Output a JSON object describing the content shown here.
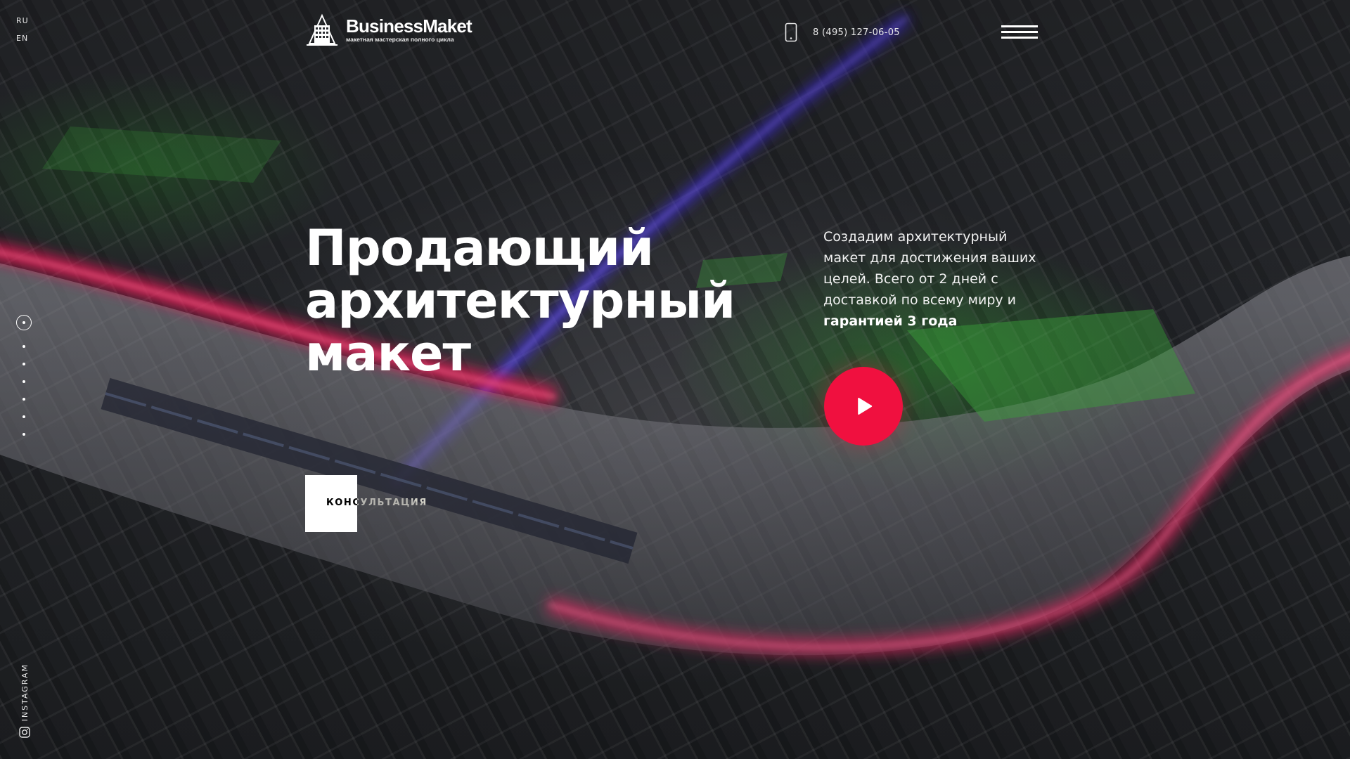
{
  "header": {
    "languages": [
      "RU",
      "EN"
    ],
    "logo": {
      "name": "BusinessMaket",
      "tagline": "макетная мастерская полного цикла",
      "icon": "building-logo-icon"
    },
    "phone": {
      "number": "8 (495) 127-06-05",
      "icon": "smartphone-icon"
    },
    "menu_icon": "hamburger-menu-icon"
  },
  "hero": {
    "headline_lines": [
      "Продающий",
      "архитектурный",
      "макет"
    ],
    "lead_text": "Создадим архитектурный макет для достижения ваших целей. Всего от 2 дней с доставкой по всему миру и",
    "lead_bold": "гарантией 3 года",
    "play_icon": "play-icon",
    "cta_label": "КОНСУЛЬТАЦИЯ"
  },
  "sidebar": {
    "slide_count": 7,
    "active_slide": 1,
    "social_label": "INSTAGRAM",
    "social_icon": "instagram-icon"
  },
  "colors": {
    "accent": "#f0103f",
    "text": "#ffffff",
    "background": "#1b1d20"
  }
}
